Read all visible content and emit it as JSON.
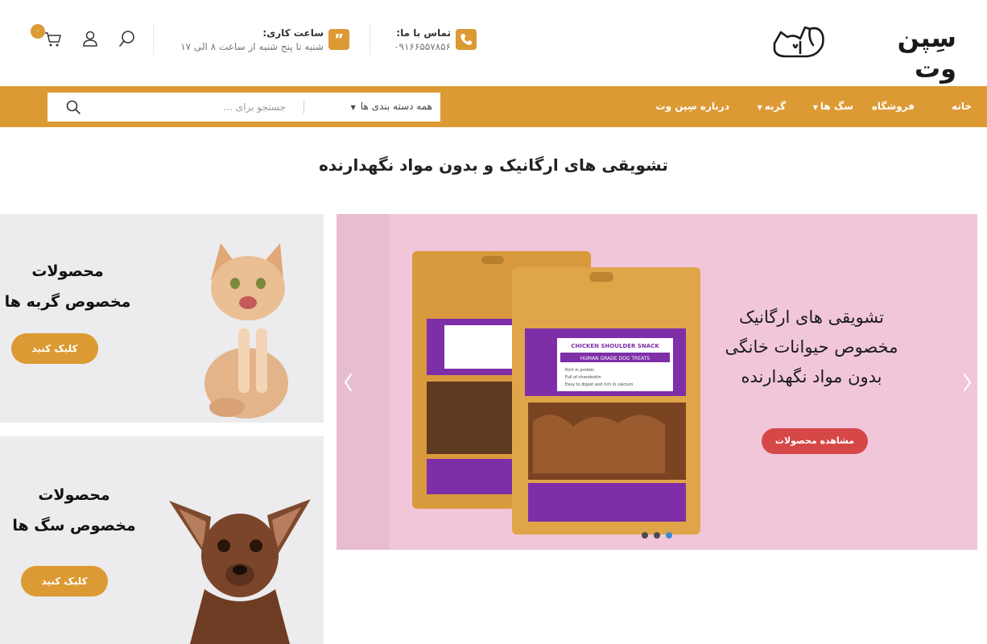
{
  "header": {
    "logo_text": "سِپن وت",
    "logo_icon": "cat-dog-logo-icon",
    "contact": {
      "title": "تماس با ما:",
      "value": "۰۹۱۶۶۵۵۷۸۵۶",
      "icon": "phone-icon"
    },
    "hours": {
      "title": "ساعت کاری:",
      "value": "شنبه تا پنج شنبه از ساعت ۸ الی ۱۷",
      "icon": "quote-icon"
    },
    "cart_count": "۰",
    "icons": [
      "search-icon",
      "user-icon",
      "cart-icon"
    ]
  },
  "nav": {
    "items": [
      {
        "label": "خانه",
        "dropdown": false
      },
      {
        "label": "فروشگاه",
        "dropdown": false
      },
      {
        "label": "سگ ها",
        "dropdown": true
      },
      {
        "label": "گربه",
        "dropdown": true
      },
      {
        "label": "درباره سِپن وت",
        "dropdown": false
      }
    ],
    "search": {
      "category": "همه دسته بندی ها",
      "placeholder": "جستجو برای ...",
      "value": ""
    }
  },
  "main": {
    "heading": "تشویقی های ارگانیک و بدون مواد نگهدارنده"
  },
  "promo": {
    "cat": {
      "line1": "محصولات",
      "line2": "مخصوص گربه ها",
      "button": "کلیک کنید"
    },
    "dog": {
      "line1": "محصولات",
      "line2": "مخصوص سگ ها",
      "button": "کلیک کنید"
    }
  },
  "slider": {
    "line1": "تشویقی های ارگانیک",
    "line2": "مخصوص حیوانات خانگی",
    "line3": "بدون مواد نگهدارنده",
    "button": "مشاهده محصولات",
    "package_label": "CHICKEN SHOULDER SNACK",
    "package_sub": "HUMAN GRADE DOG TREATS",
    "package_bullets": [
      "Rich in protein",
      "Full of chondroitin",
      "Easy to digest and rich in calcium"
    ],
    "dots": 3,
    "active_dot": 3
  },
  "colors": {
    "accent": "#dc9a34",
    "slide_button": "#d64848",
    "slide_bg": "#f1c6d9",
    "card_bg": "#ecebee",
    "active_dot": "#3b8bd6"
  }
}
